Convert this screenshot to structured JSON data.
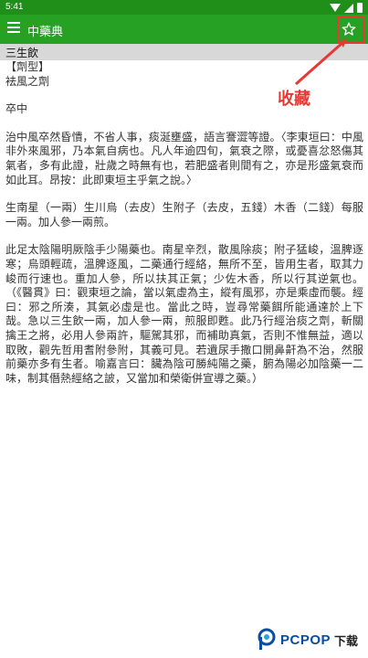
{
  "status_bar": {
    "time": "5:41"
  },
  "app_bar": {
    "title": "中藥典",
    "menu_icon": "menu-icon",
    "favorite_icon": "star-outline-icon"
  },
  "section": {
    "title": "三生飲"
  },
  "content": {
    "type_label": "【劑型】",
    "type_value": "袪風之劑",
    "heading": "卒中",
    "paragraphs": [
      "治中風卒然昏憒，不省人事，痰涎壅盛，語言謇澀等證。〈李東垣曰：中風非外來風邪，乃本氣自病也。凡人年逾四旬，氣衰之際，或憂喜忿怒傷其氣者，多有此證，壯歲之時無有也，若肥盛者則間有之，亦是形盛氣衰而如此耳。昂按：此即東垣主乎氣之說。〉",
      "生南星（一兩）生川烏（去皮）生附子（去皮，五錢）木香（二錢）每服一兩。加人參一兩煎。",
      "此足太陰陽明厥陰手少陽藥也。南星辛烈，散風除痰；附子猛峻，溫脾逐寒；烏頭輕疏，溫脾逐風，二藥通行經絡，無所不至，皆用生者，取其力峻而行速也。重加人參，所以扶其正氣；少佐木香，所以行其逆氣也。（《醫貫》曰：觀東垣之論，當以氣虛為主，縱有風邪，亦是乘虛而襲。經曰：邪之所湊，其氣必虛是也。當此之時，豈尋常藥餌所能通達於上下哉。急以三生飲一兩，加人參一兩，煎服即甦。此乃行經治痰之劑，斬關擒王之將，必用人參兩許，驅駕其邪，而補助真氣，否則不惟無益，適以取敗，觀先哲用耆附參附，其義可見。若遺尿手撒口開鼻鼾為不治，然服前藥亦多有生者。喻嘉言曰：臟為陰可勝純陽之藥，腑為陽必加陰藥一二味，制其僭熱經絡之詖，又當加和榮衛併宣導之藥。）"
    ]
  },
  "annotation": {
    "label": "收藏"
  },
  "watermark": {
    "brand": "PCPOP",
    "suffix": "下载"
  },
  "colors": {
    "status_bar": "#1f8f1a",
    "app_bar": "#27a123",
    "section_bar": "#d8d8d8",
    "annotation": "#e53935"
  }
}
